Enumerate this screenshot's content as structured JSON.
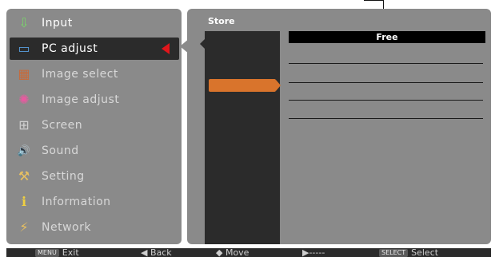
{
  "menu": {
    "items": [
      {
        "label": "Input",
        "icon": "input-icon",
        "glyph": "⇩"
      },
      {
        "label": "PC adjust",
        "icon": "pc-adjust-icon",
        "glyph": "▭"
      },
      {
        "label": "Image select",
        "icon": "image-select-icon",
        "glyph": "▦"
      },
      {
        "label": "Image adjust",
        "icon": "image-adjust-icon",
        "glyph": "✺"
      },
      {
        "label": "Screen",
        "icon": "screen-icon",
        "glyph": "⊞"
      },
      {
        "label": "Sound",
        "icon": "sound-icon",
        "glyph": "🔊"
      },
      {
        "label": "Setting",
        "icon": "setting-icon",
        "glyph": "⚒"
      },
      {
        "label": "Information",
        "icon": "information-icon",
        "glyph": "ℹ"
      },
      {
        "label": "Network",
        "icon": "network-icon",
        "glyph": "⚡"
      }
    ],
    "selected_index": 1
  },
  "panel": {
    "title": "Store",
    "slots": [
      "Free",
      "",
      "",
      "",
      ""
    ]
  },
  "guide": {
    "exit_key": "MENU",
    "exit_label": "Exit",
    "back_label": "◀ Back",
    "move_label": "◆ Move",
    "next_label": "▶-----",
    "select_key": "SELECT",
    "select_label": "Select"
  },
  "colors": {
    "panel_bg": "#8a8a8a",
    "dark": "#2b2b2b",
    "accent_orange": "#d9742c",
    "selection_arrow": "#e0161b"
  }
}
